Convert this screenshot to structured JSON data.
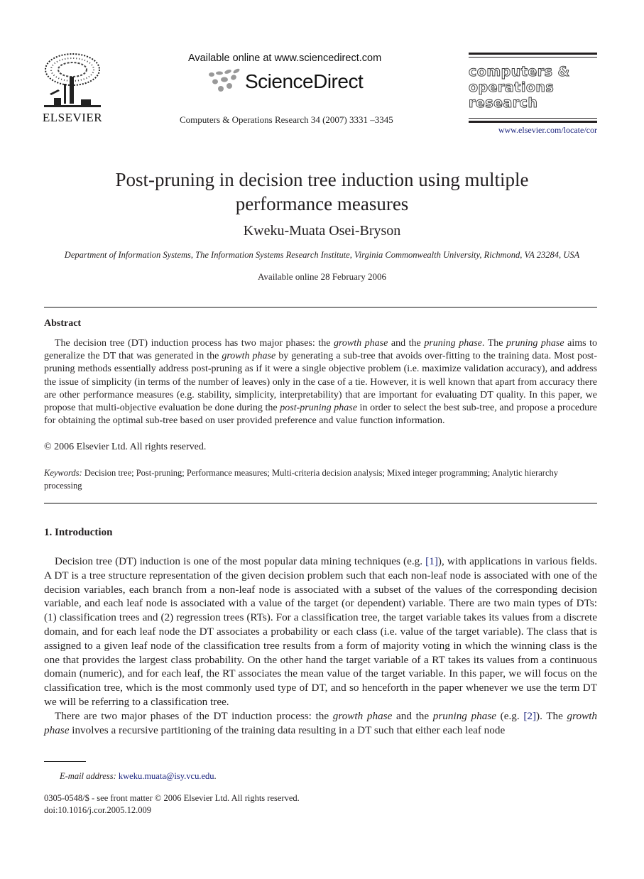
{
  "header": {
    "publisher": "ELSEVIER",
    "available_online_at": "Available online at www.sciencedirect.com",
    "sciencedirect_brand": "ScienceDirect",
    "journal_ref": "Computers & Operations Research 34 (2007) 3331 –3345",
    "journal_title_lines": [
      "computers &",
      "operations",
      "research"
    ],
    "journal_url": "www.elsevier.com/locate/cor"
  },
  "article": {
    "title_lines": [
      "Post-pruning in decision tree induction using multiple",
      "performance measures"
    ],
    "author": "Kweku-Muata Osei-Bryson",
    "affiliation": "Department of Information Systems, The Information Systems Research Institute, Virginia Commonwealth University, Richmond, VA 23284, USA",
    "available_online": "Available online 28 February 2006"
  },
  "abstract": {
    "heading": "Abstract",
    "segments": [
      {
        "t": "The decision tree (DT) induction process has two major phases: the ",
        "i": false
      },
      {
        "t": "growth phase",
        "i": true
      },
      {
        "t": " and the ",
        "i": false
      },
      {
        "t": "pruning phase",
        "i": true
      },
      {
        "t": ". The ",
        "i": false
      },
      {
        "t": "pruning phase",
        "i": true
      },
      {
        "t": " aims to generalize the DT that was generated in the ",
        "i": false
      },
      {
        "t": "growth phase",
        "i": true
      },
      {
        "t": " by generating a sub-tree that avoids over-fitting to the training data. Most post-pruning methods essentially address post-pruning as if it were a single objective problem (i.e. maximize validation accuracy), and address the issue of simplicity (in terms of the number of leaves) only in the case of a tie. However, it is well known that apart from accuracy there are other performance measures (e.g. stability, simplicity, interpretability) that are important for evaluating DT quality. In this paper, we propose that multi-objective evaluation be done during the ",
        "i": false
      },
      {
        "t": "post-pruning phase",
        "i": true
      },
      {
        "t": " in order to select the best sub-tree, and propose a procedure for obtaining the optimal sub-tree based on user provided preference and value function information.",
        "i": false
      }
    ],
    "copyright": "© 2006 Elsevier Ltd. All rights reserved.",
    "keywords_label": "Keywords:",
    "keywords": " Decision tree; Post-pruning; Performance measures; Multi-criteria decision analysis; Mixed integer programming; Analytic hierarchy processing"
  },
  "introduction": {
    "heading": "1.  Introduction",
    "paragraphs": [
      [
        {
          "t": "Decision  tree (DT) induction is one of the most popular data mining techniques (e.g. ",
          "k": "n"
        },
        {
          "t": "[1]",
          "k": "c"
        },
        {
          "t": "), with applications in various fields. A DT is a tree structure representation of the given decision problem such that each non-leaf node is associated with one of the decision variables, each branch from a non-leaf node is associated with a subset of the values of the corresponding decision variable, and each leaf node is associated with a value of the target (or dependent) variable. There are two main types of DTs: (1) classification trees and (2) regression trees (RTs). For a classification tree, the target variable takes its values from a discrete domain, and for each leaf node the DT associates a probability or each class (i.e. value of the target variable). The class that is assigned to a given leaf node of the classification tree results from a form of majority voting in which the winning class is the one that provides the largest class probability. On the other hand the target variable of a RT takes its values from a continuous domain (numeric), and for each leaf, the RT associates the mean value of the target variable. In this paper, we will focus on the classification tree, which is the most commonly used type of DT, and so henceforth in the paper whenever we use the term DT we will be referring to a classification tree.",
          "k": "n"
        }
      ],
      [
        {
          "t": "There are two major phases of the DT induction process: the ",
          "k": "n"
        },
        {
          "t": "growth phase",
          "k": "i"
        },
        {
          "t": " and the ",
          "k": "n"
        },
        {
          "t": "pruning phase",
          "k": "i"
        },
        {
          "t": " (e.g. ",
          "k": "n"
        },
        {
          "t": "[2]",
          "k": "c"
        },
        {
          "t": "). The ",
          "k": "n"
        },
        {
          "t": "growth phase",
          "k": "i"
        },
        {
          "t": " involves a recursive partitioning of the training data resulting in a DT such that either each leaf node",
          "k": "n"
        }
      ]
    ]
  },
  "footnote": {
    "email_label": "E-mail address:",
    "email": "kweku.muata@isy.vcu.edu",
    "email_suffix": ".",
    "front_matter": "0305-0548/$ - see front matter © 2006 Elsevier Ltd. All rights reserved.",
    "doi": "doi:10.1016/j.cor.2005.12.009"
  }
}
